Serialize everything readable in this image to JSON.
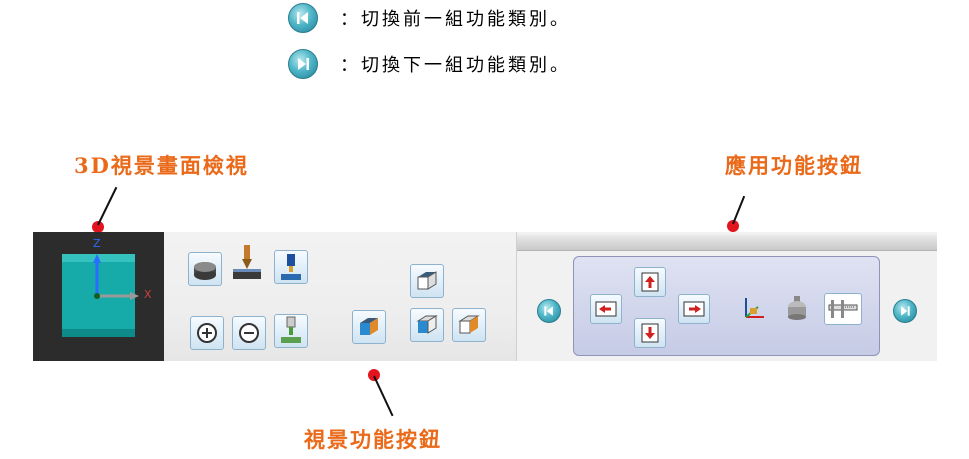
{
  "legend": {
    "prev_text": "：切換前一組功能類別。",
    "next_text": "：切換下一組功能類別。"
  },
  "annotations": {
    "viewport_label": "3D視景畫面檢視",
    "app_buttons_label": "應用功能按鈕",
    "view_buttons_label": "視景功能按鈕"
  },
  "viewport": {
    "axis_z": "Z",
    "axis_x": "X"
  },
  "colors": {
    "annotation_text": "#ea6a1a",
    "pointer_dot": "#e2141e",
    "viewport_bg": "#2c2c2c",
    "cube": "#16aaa8",
    "nav_button": "#4fb6c8"
  },
  "icons": {
    "prev": "skip-previous-icon",
    "next": "skip-next-icon",
    "view_buttons": [
      "tool-part-view-icon",
      "tool-spindle-view-icon",
      "tool-holder-view-icon",
      "zoom-in-icon",
      "zoom-out-icon",
      "tool-offset-view-icon",
      "isometric-cube-icon",
      "top-cube-icon",
      "front-cube-icon",
      "right-cube-icon"
    ],
    "app_buttons": [
      "move-left-icon",
      "move-up-icon",
      "move-down-icon",
      "move-right-icon",
      "coordinate-axes-icon",
      "probe-icon",
      "caliper-icon"
    ]
  }
}
